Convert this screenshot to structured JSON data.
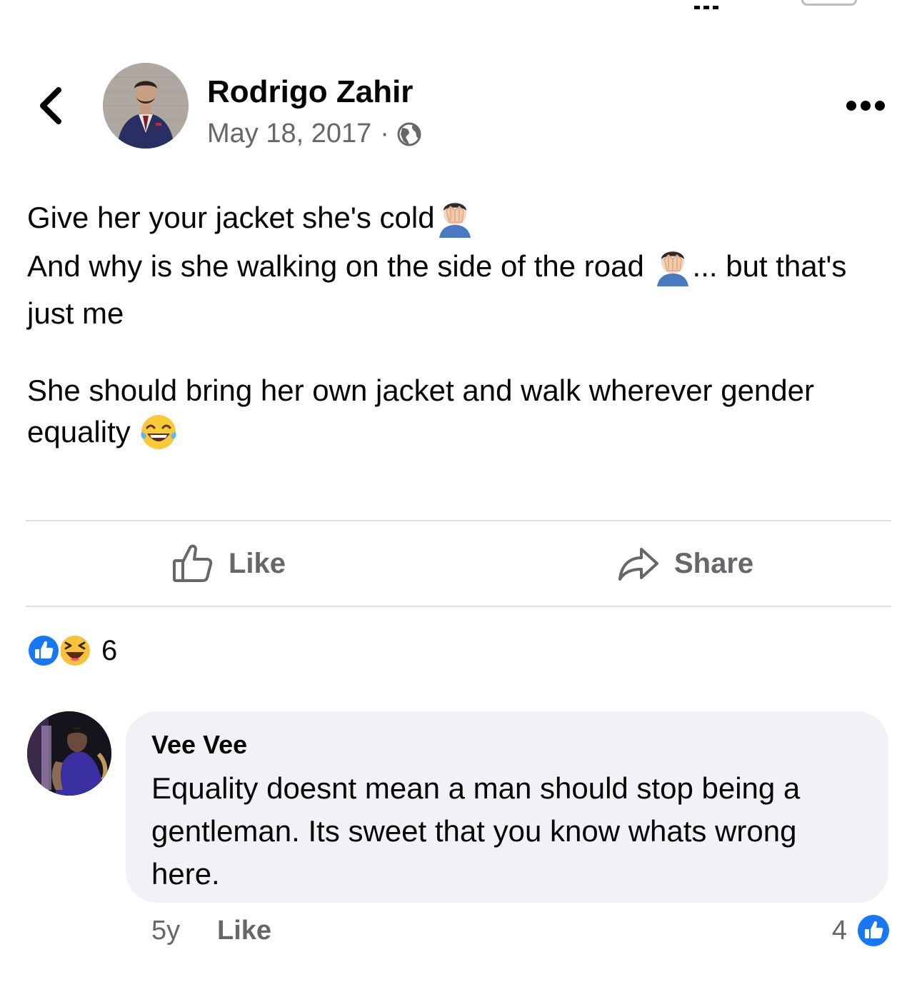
{
  "post": {
    "author": "Rodrigo Zahir",
    "date": "May 18, 2017",
    "separator": "·",
    "privacy_icon": "globe-icon",
    "text": {
      "line1": "Give her your jacket she's cold",
      "line2a": "And why is she walking on the side of the road",
      "line2b": "... but that's just me",
      "paragraph2": "She should bring her own jacket and walk wherever gender equality"
    }
  },
  "actions": {
    "like_label": "Like",
    "share_label": "Share"
  },
  "reactions": {
    "count": "6",
    "types": [
      "like",
      "haha"
    ]
  },
  "comment": {
    "author": "Vee Vee",
    "text": "Equality doesnt mean a man should stop being a gentleman. Its sweet that you know whats wrong here.",
    "age": "5y",
    "like_label": "Like",
    "reaction_count": "4"
  },
  "colors": {
    "fb_blue": "#1877f2",
    "secondary_text": "#65676b",
    "bubble_bg": "#f0f2f5",
    "divider": "#dadde1"
  }
}
